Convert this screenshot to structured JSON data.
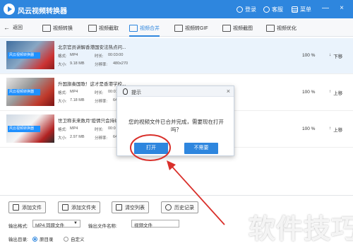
{
  "app": {
    "title": "风云视频转换器",
    "header_links": [
      {
        "label": "登录",
        "icon": "user-icon"
      },
      {
        "label": "客服",
        "icon": "headset-icon"
      },
      {
        "label": "菜单",
        "icon": "menu-icon"
      }
    ],
    "window_controls": [
      "—",
      "×"
    ],
    "accent": "#2e86de"
  },
  "toolbar": {
    "back_label": "返回",
    "tools": [
      {
        "label": "视频转换",
        "icon": "video-convert-icon"
      },
      {
        "label": "视频截取",
        "icon": "video-clip-icon"
      },
      {
        "label": "视频合并",
        "icon": "video-merge-icon"
      },
      {
        "label": "视频转GIF",
        "icon": "video-gif-icon"
      },
      {
        "label": "视频截图",
        "icon": "video-screenshot-icon"
      },
      {
        "label": "视频优化",
        "icon": "video-optimize-icon"
      }
    ],
    "active": "视频合并"
  },
  "files": [
    {
      "name": "北京官员讲解香港国安法热点问...",
      "format_label": "格式:",
      "format": "MP4",
      "duration_label": "时长:",
      "duration": "00:03:00",
      "size_label": "大小:",
      "size": "9.18 MB",
      "resolution_label": "分辨率:",
      "resolution": "480x270",
      "percent": "100 %",
      "move_label": "下移",
      "thumb_caption": "风云视频转换器"
    },
    {
      "name": "升国旗奏国歌！这才是香港学校...",
      "format_label": "格式:",
      "format": "MP4",
      "duration_label": "时长:",
      "duration": "00:01",
      "size_label": "大小:",
      "size": "7.18 MB",
      "resolution_label": "分辨率:",
      "resolution": "64",
      "percent": "100 %",
      "move_label": "上移",
      "thumb_caption": "风云视频转换器"
    },
    {
      "name": "世卫称未来数月“疫情只会持续...",
      "format_label": "格式:",
      "format": "MP4",
      "duration_label": "时长:",
      "duration": "00:0",
      "size_label": "大小:",
      "size": "2.97 MB",
      "resolution_label": "分辨率:",
      "resolution": "64",
      "percent": "100 %",
      "move_label": "上移",
      "thumb_caption": "风云视频转换器"
    }
  ],
  "dialog": {
    "title": "提示",
    "message_line1": "您的视频文件已合并完成，需要现在打开",
    "message_line2": "吗？",
    "open_label": "打开",
    "no_label": "不需要",
    "close_glyph": "×"
  },
  "actions": [
    {
      "label": "添加文件",
      "icon": "add-file-icon"
    },
    {
      "label": "添加文件夹",
      "icon": "add-folder-icon"
    },
    {
      "label": "清空列表",
      "icon": "clear-list-icon"
    },
    {
      "label": "历史记录",
      "icon": "history-icon"
    }
  ],
  "output": {
    "format_label": "输出格式:",
    "format_value": "MP4 同原文件",
    "name_label": "输出文件名称:",
    "name_value": "视频文件",
    "dir_label": "输出目录:",
    "dir_options": [
      "原目录",
      "自定义"
    ],
    "dir_selected": "原目录"
  },
  "watermark": "软件技巧"
}
